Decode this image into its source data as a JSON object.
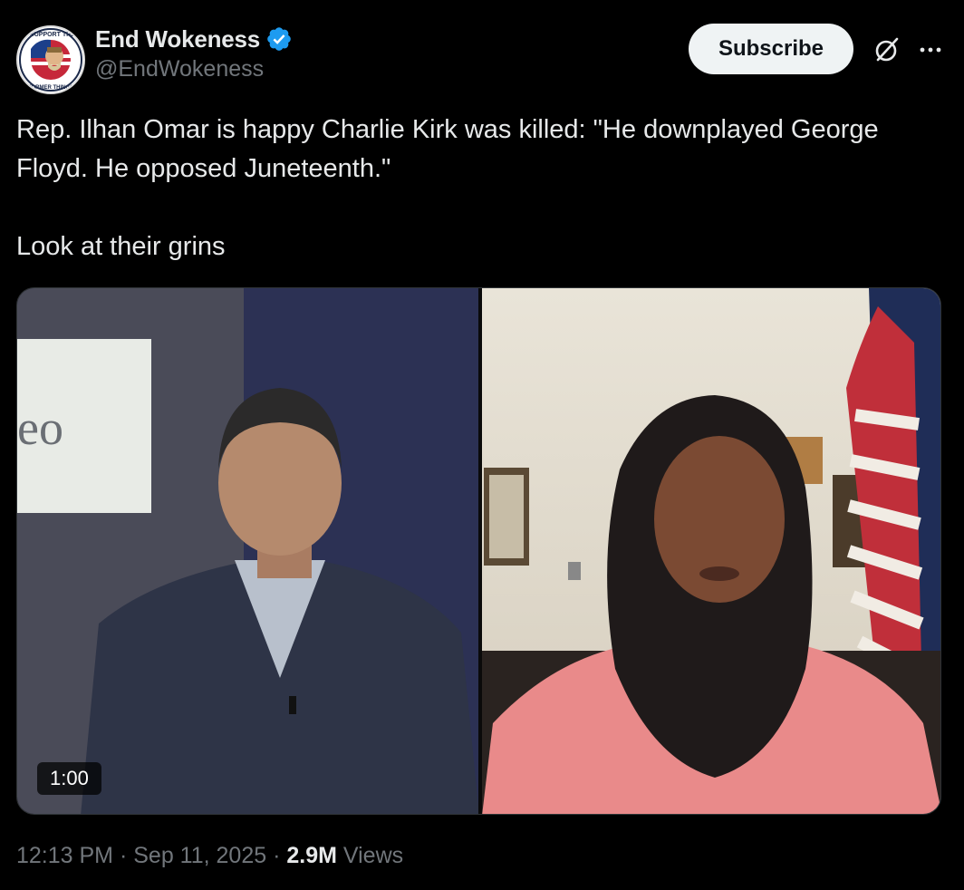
{
  "author": {
    "display_name": "End Wokeness",
    "handle": "@EndWokeness",
    "verified": true,
    "avatar_icon": "patriotic-badge-avatar",
    "avatar_ring_text_top": "I SUPPORT THE",
    "avatar_ring_text_bottom": "FORMER THINGS"
  },
  "actions": {
    "subscribe_label": "Subscribe",
    "grok_icon": "grok-icon",
    "more_icon": "more-dots-icon"
  },
  "tweet": {
    "line1": "Rep. Ilhan Omar is happy Charlie Kirk was killed: \"He downplayed George Floyd. He opposed Juneteenth.\"",
    "line2": "Look at their grins"
  },
  "media": {
    "type": "video",
    "duration": "1:00",
    "left_panel_sign_text": "eo"
  },
  "meta": {
    "time": "12:13 PM",
    "separator": " · ",
    "date": "Sep 11, 2025",
    "views_count": "2.9M",
    "views_label": " Views"
  },
  "colors": {
    "background": "#000000",
    "text_primary": "#e7e9ea",
    "text_secondary": "#71767b",
    "verified_blue": "#1d9bf0",
    "subscribe_bg": "#eff3f4"
  }
}
